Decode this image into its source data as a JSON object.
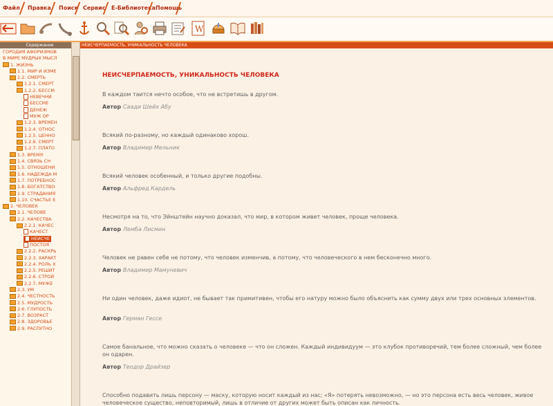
{
  "menu": {
    "items": [
      "Файл",
      "Правка",
      "Поиск",
      "Сервис",
      "Е-Библиотека",
      "Помощь"
    ]
  },
  "toolbar": {
    "icons": [
      "back-arrow-icon",
      "folder-open-icon",
      "phone-icon",
      "phone-icon",
      "anchor-icon",
      "search-icon",
      "search-text-icon",
      "user-search-icon",
      "printer-icon",
      "notes-icon",
      "word-doc-icon",
      "globe-icon",
      "book-icon",
      "library-icon"
    ]
  },
  "left_pane": {
    "header": "Содержание",
    "tree": [
      {
        "label": "ГОРОДИЯ АФОРИЗМОВ",
        "indent": 0,
        "type": "text"
      },
      {
        "label": "В МИРЕ МУДРЫХ МЫСЛ",
        "indent": 0,
        "type": "text"
      },
      {
        "label": "1. ЖИЗНЬ",
        "indent": 0,
        "type": "folder"
      },
      {
        "label": "1.1. МИР И ИЗМЕ",
        "indent": 1,
        "type": "folder"
      },
      {
        "label": "1.2. СМЕРТЬ",
        "indent": 1,
        "type": "folder"
      },
      {
        "label": "1.2.1. СМЕРТ",
        "indent": 2,
        "type": "folder"
      },
      {
        "label": "1.2.2. БЕССМ",
        "indent": 2,
        "type": "folder"
      },
      {
        "label": "НЕВЕЧНИ",
        "indent": 3,
        "type": "doc"
      },
      {
        "label": "БЕССМЕ",
        "indent": 3,
        "type": "doc"
      },
      {
        "label": "ДЕНЕЖ",
        "indent": 3,
        "type": "doc"
      },
      {
        "label": "МУЖ ОР",
        "indent": 3,
        "type": "doc"
      },
      {
        "label": "1.2.3. ВРЕМЕН",
        "indent": 2,
        "type": "folder"
      },
      {
        "label": "1.2.4. ОТНОС",
        "indent": 2,
        "type": "folder"
      },
      {
        "label": "1.2.5. ЦЕННО",
        "indent": 2,
        "type": "folder"
      },
      {
        "label": "1.2.6. СМЕРТ",
        "indent": 2,
        "type": "folder"
      },
      {
        "label": "1.2.7. ПЛАТО",
        "indent": 2,
        "type": "folder"
      },
      {
        "label": "1.3. ВРЕМЯ",
        "indent": 1,
        "type": "folder"
      },
      {
        "label": "1.4. СВЯЗЬ СН",
        "indent": 1,
        "type": "folder"
      },
      {
        "label": "1.5. ОТНОШЕНИ",
        "indent": 1,
        "type": "folder"
      },
      {
        "label": "1.6. НАДЕЖДА М",
        "indent": 1,
        "type": "folder"
      },
      {
        "label": "1.7. ПОТРЕБНОС",
        "indent": 1,
        "type": "folder"
      },
      {
        "label": "1.8. БОГАТСТВО",
        "indent": 1,
        "type": "folder"
      },
      {
        "label": "1.9. СТРАДАНИЯ",
        "indent": 1,
        "type": "folder"
      },
      {
        "label": "1.10. СЧАСТЬЕ Е",
        "indent": 1,
        "type": "folder"
      },
      {
        "label": "2. ЧЕЛОВЕК",
        "indent": 0,
        "type": "folder"
      },
      {
        "label": "2.1. ЧЕЛОВЕ",
        "indent": 1,
        "type": "folder"
      },
      {
        "label": "2.2. КАЧЕСТВА",
        "indent": 1,
        "type": "folder"
      },
      {
        "label": "2.2.1. КАЧЕС",
        "indent": 2,
        "type": "folder"
      },
      {
        "label": "КАЧЕСТ",
        "indent": 3,
        "type": "doc"
      },
      {
        "label": "НЕИСЧЕ",
        "indent": 3,
        "type": "doc",
        "selected": true
      },
      {
        "label": "ПОСТОЯ",
        "indent": 3,
        "type": "doc"
      },
      {
        "label": "2.2.2. РАСКРЬ",
        "indent": 2,
        "type": "folder"
      },
      {
        "label": "2.2.3. ХАРАКТ",
        "indent": 2,
        "type": "folder"
      },
      {
        "label": "2.2.4. РОЛЬ Х",
        "indent": 2,
        "type": "folder"
      },
      {
        "label": "2.2.5. РЕШИТ",
        "indent": 2,
        "type": "folder"
      },
      {
        "label": "2.2.6. СТРОЙ",
        "indent": 2,
        "type": "folder"
      },
      {
        "label": "2.2.7. МУЖЕ",
        "indent": 2,
        "type": "folder"
      },
      {
        "label": "2.3. УМ",
        "indent": 1,
        "type": "folder"
      },
      {
        "label": "2.4. ЧЕСТНОСТЬ",
        "indent": 1,
        "type": "folder"
      },
      {
        "label": "2.5. МУДРОСТЬ",
        "indent": 1,
        "type": "folder"
      },
      {
        "label": "2.6. ГЛУПОСТЬ",
        "indent": 1,
        "type": "folder"
      },
      {
        "label": "2.7. ВОЗРАСТ",
        "indent": 1,
        "type": "folder"
      },
      {
        "label": "2.8. ЗДОРОВЬЕ",
        "indent": 1,
        "type": "folder"
      },
      {
        "label": "2.9. РАСПУТНО",
        "indent": 1,
        "type": "folder"
      }
    ]
  },
  "content": {
    "header": "НЕИСЧЕРПАЕМОСТЬ, УНИКАЛЬНОСТЬ ЧЕЛОВЕКА",
    "title": "НЕИСЧЕРПАЕМОСТЬ, УНИКАЛЬНОСТЬ ЧЕЛОВЕКА",
    "quotes": [
      {
        "text": "В каждом таится нечто особое, что не встретишь в другом.",
        "author": "Саади Шейх Абу"
      },
      {
        "text": "Всякий по-разному, но каждый одинаково хорош.",
        "author": "Владимир Мельник"
      },
      {
        "text": "Всякий человек особенный, и только другие подобны.",
        "author": "Альфред Кардель"
      },
      {
        "text": "Несмотря на то, что Эйнштейн научно доказал, что мир, в котором живет человек, проще человека.",
        "author": "Лемба Лисмин"
      },
      {
        "text": "Человек не равен себе не потому, что человек изменчив, а потому, что человеческого в нем бесконечно много.",
        "author": "Владимир Мамуневич"
      },
      {
        "text": "Ни один человек, даже идиот, не бывает так примитивен, чтобы его натуру можно было объяснить как сумму двух или трех основных элементов.",
        "author": "Герман Гессе"
      },
      {
        "text": "Самое банальное, что можно сказать о человеке — что он сложен. Каждый индивидуум — это клубок противоречий, тем более сложный, чем более он одарен.",
        "author": "Теодор Драйзер"
      },
      {
        "text": "Способно подавить лишь персону — маску, которую носит каждый из нас; «Я» потерять невозможно, — но это персона есть весь человек, живое человеческое существо, неповторимый, лишь в отличие от других может быть описан как личность.",
        "author": ""
      }
    ]
  }
}
